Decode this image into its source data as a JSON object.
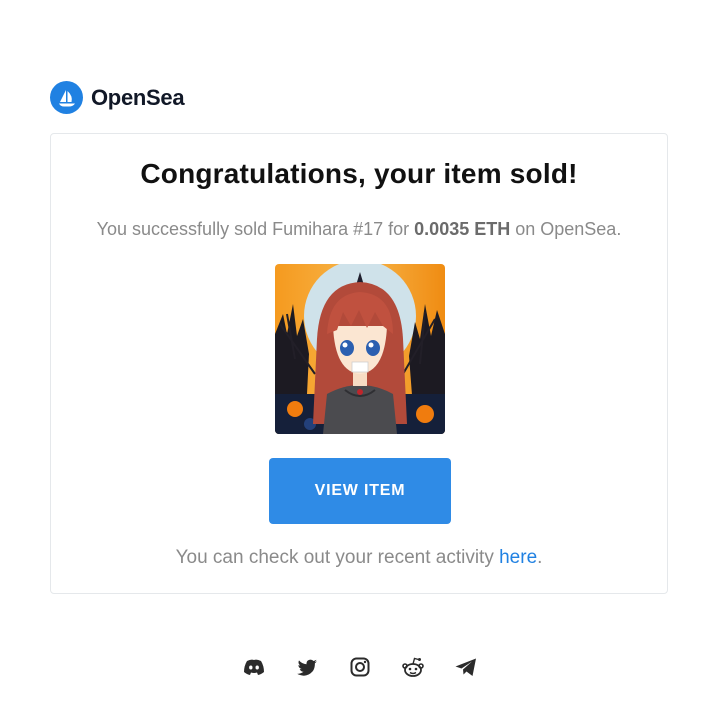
{
  "brand": {
    "name": "OpenSea",
    "logo_icon": "opensea-ship-icon",
    "color": "#2081e2"
  },
  "email": {
    "headline": "Congratulations, your item sold!",
    "sold_prefix": "You successfully sold ",
    "item_name": "Fumihara #17",
    "sold_middle": " for ",
    "price": "0.0035 ETH",
    "sold_suffix": " on OpenSea.",
    "button_label": "VIEW ITEM",
    "button_color": "#2f8be6",
    "activity_prefix": "You can check out your recent activity ",
    "activity_link": "here",
    "activity_suffix": "."
  },
  "socials": [
    {
      "icon": "discord-icon"
    },
    {
      "icon": "twitter-icon"
    },
    {
      "icon": "instagram-icon"
    },
    {
      "icon": "reddit-icon"
    },
    {
      "icon": "telegram-icon"
    }
  ]
}
